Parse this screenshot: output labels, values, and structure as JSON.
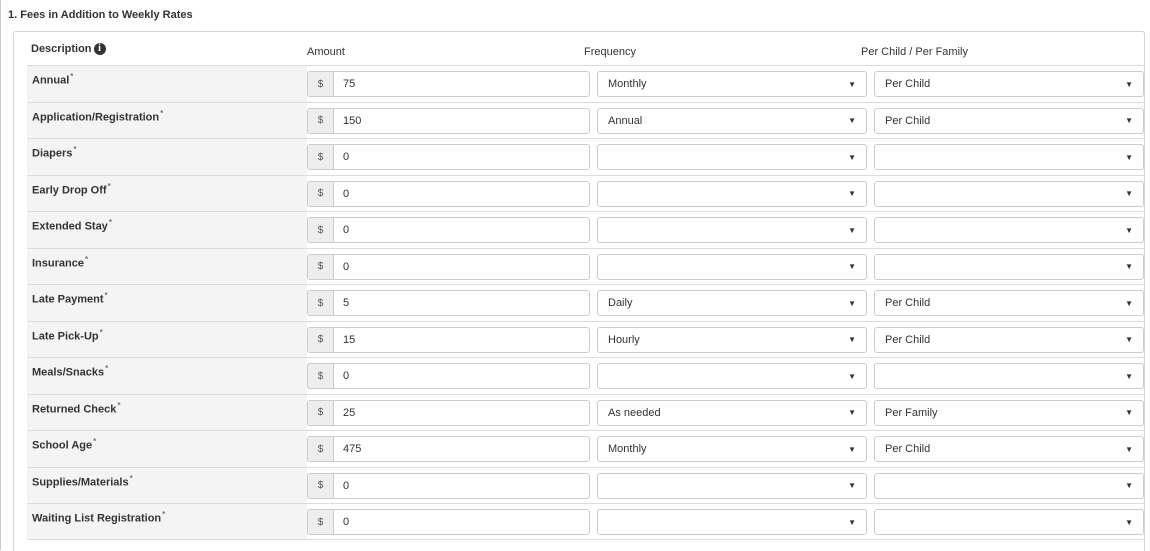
{
  "section": {
    "title": "1. Fees in Addition to Weekly Rates"
  },
  "headers": {
    "description": "Description",
    "amount": "Amount",
    "frequency": "Frequency",
    "per": "Per Child / Per Family"
  },
  "icons": {
    "info": "info-circle-icon",
    "required": "asterisk-icon",
    "caret": "caret-down-icon"
  },
  "currency_symbol": "$",
  "required_marker": "*",
  "caret_glyph": "▼",
  "rows": [
    {
      "label": "Annual",
      "amount": "75",
      "frequency": "Monthly",
      "per": "Per Child"
    },
    {
      "label": "Application/Registration",
      "amount": "150",
      "frequency": "Annual",
      "per": "Per Child"
    },
    {
      "label": "Diapers",
      "amount": "0",
      "frequency": "",
      "per": ""
    },
    {
      "label": "Early Drop Off",
      "amount": "0",
      "frequency": "",
      "per": ""
    },
    {
      "label": "Extended Stay",
      "amount": "0",
      "frequency": "",
      "per": ""
    },
    {
      "label": "Insurance",
      "amount": "0",
      "frequency": "",
      "per": ""
    },
    {
      "label": "Late Payment",
      "amount": "5",
      "frequency": "Daily",
      "per": "Per Child"
    },
    {
      "label": "Late Pick-Up",
      "amount": "15",
      "frequency": "Hourly",
      "per": "Per Child"
    },
    {
      "label": "Meals/Snacks",
      "amount": "0",
      "frequency": "",
      "per": ""
    },
    {
      "label": "Returned Check",
      "amount": "25",
      "frequency": "As needed",
      "per": "Per Family"
    },
    {
      "label": "School Age",
      "amount": "475",
      "frequency": "Monthly",
      "per": "Per Child"
    },
    {
      "label": "Supplies/Materials",
      "amount": "0",
      "frequency": "",
      "per": ""
    },
    {
      "label": "Waiting List Registration",
      "amount": "0",
      "frequency": "",
      "per": ""
    }
  ]
}
